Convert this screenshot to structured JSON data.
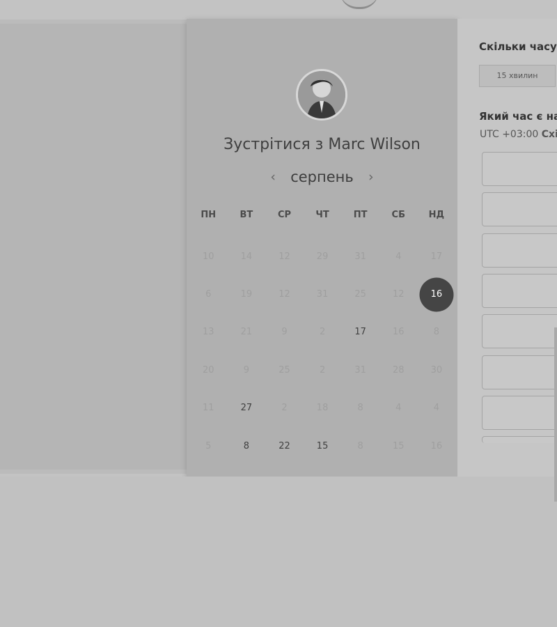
{
  "booking": {
    "title_prefix": "Зустрітися з",
    "host_name": "Marc Wilson",
    "month": "серпень",
    "weekdays": [
      "ПН",
      "ВТ",
      "СР",
      "ЧТ",
      "ПТ",
      "СБ",
      "НД"
    ],
    "days": [
      {
        "label": "10",
        "state": "disabled"
      },
      {
        "label": "14",
        "state": "disabled"
      },
      {
        "label": "12",
        "state": "disabled"
      },
      {
        "label": "29",
        "state": "disabled"
      },
      {
        "label": "31",
        "state": "disabled"
      },
      {
        "label": "4",
        "state": "disabled"
      },
      {
        "label": "17",
        "state": "disabled"
      },
      {
        "label": "6",
        "state": "disabled"
      },
      {
        "label": "19",
        "state": "disabled"
      },
      {
        "label": "12",
        "state": "disabled"
      },
      {
        "label": "31",
        "state": "disabled"
      },
      {
        "label": "25",
        "state": "disabled"
      },
      {
        "label": "12",
        "state": "disabled"
      },
      {
        "label": "16",
        "state": "selected"
      },
      {
        "label": "13",
        "state": "disabled"
      },
      {
        "label": "21",
        "state": "disabled"
      },
      {
        "label": "9",
        "state": "disabled"
      },
      {
        "label": "2",
        "state": "disabled"
      },
      {
        "label": "17",
        "state": "available"
      },
      {
        "label": "16",
        "state": "disabled"
      },
      {
        "label": "8",
        "state": "disabled"
      },
      {
        "label": "20",
        "state": "disabled"
      },
      {
        "label": "9",
        "state": "disabled"
      },
      {
        "label": "25",
        "state": "disabled"
      },
      {
        "label": "2",
        "state": "disabled"
      },
      {
        "label": "31",
        "state": "disabled"
      },
      {
        "label": "28",
        "state": "disabled"
      },
      {
        "label": "30",
        "state": "disabled"
      },
      {
        "label": "11",
        "state": "disabled"
      },
      {
        "label": "27",
        "state": "available"
      },
      {
        "label": "2",
        "state": "disabled"
      },
      {
        "label": "18",
        "state": "disabled"
      },
      {
        "label": "8",
        "state": "disabled"
      },
      {
        "label": "4",
        "state": "disabled"
      },
      {
        "label": "4",
        "state": "disabled"
      },
      {
        "label": "5",
        "state": "disabled"
      },
      {
        "label": "8",
        "state": "available"
      },
      {
        "label": "22",
        "state": "available"
      },
      {
        "label": "15",
        "state": "available"
      },
      {
        "label": "8",
        "state": "disabled"
      },
      {
        "label": "15",
        "state": "disabled"
      },
      {
        "label": "16",
        "state": "disabled"
      }
    ]
  },
  "scheduler": {
    "duration_question": "Скільки часу в",
    "duration_option": "15 хвилин",
    "time_question": "Який час є най",
    "timezone_offset": "UTC +03:00",
    "timezone_name": "Схід"
  },
  "icons": {
    "prev": "‹",
    "next": "›"
  },
  "colors": {
    "selected_day": "#454545",
    "panel": "#b0b0b0"
  }
}
